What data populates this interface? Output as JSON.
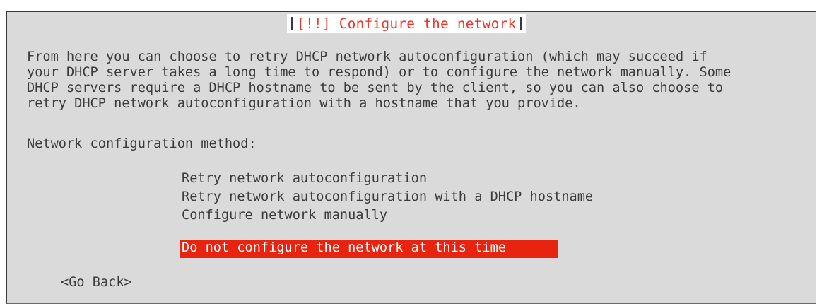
{
  "dialog": {
    "title": "[!!] Configure the network",
    "description": [
      "From here you can choose to retry DHCP network autoconfiguration (which may succeed if",
      "your DHCP server takes a long time to respond) or to configure the network manually. Some",
      "DHCP servers require a DHCP hostname to be sent by the client, so you can also choose to",
      "retry DHCP network autoconfiguration with a hostname that you provide."
    ],
    "method_label": "Network configuration method:",
    "options": [
      "Retry network autoconfiguration",
      "Retry network autoconfiguration with a DHCP hostname",
      "Configure network manually",
      "Do not configure the network at this time"
    ],
    "selected_option": "Do not configure the network at this time",
    "go_back_label": "<Go Back>"
  },
  "colors": {
    "dialog_background": "#dadada",
    "title_text": "#e8372b",
    "selection_background": "#e8230f",
    "selection_text": "#ffffff",
    "body_text": "#3b3b3b"
  }
}
